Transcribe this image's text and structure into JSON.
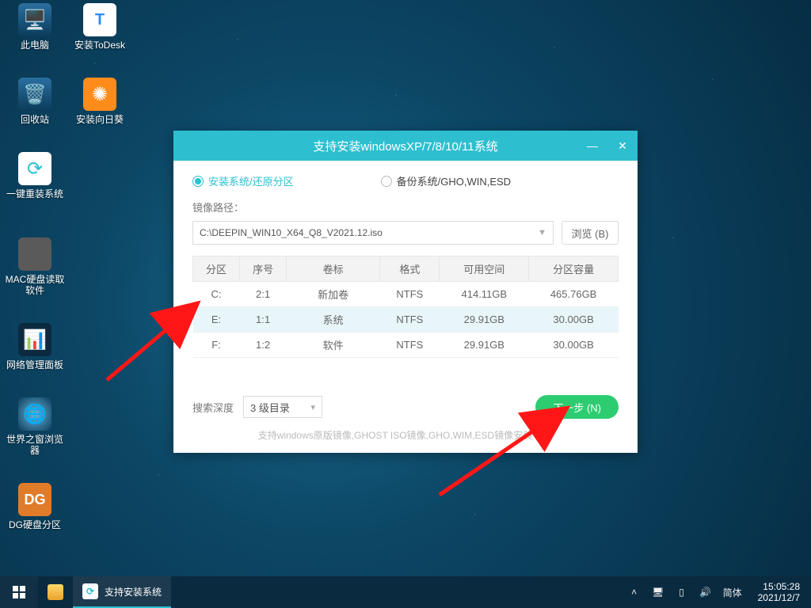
{
  "desktop_icons": [
    {
      "key": "pc",
      "label": "此电脑"
    },
    {
      "key": "todesk",
      "label": "安装ToDesk"
    },
    {
      "key": "recycle",
      "label": "回收站"
    },
    {
      "key": "sunflower",
      "label": "安装向日葵"
    },
    {
      "key": "reinstall",
      "label": "一键重装系统"
    },
    {
      "key": "macdisk",
      "label": "MAC硬盘读取软件"
    },
    {
      "key": "netpanel",
      "label": "网络管理面板"
    },
    {
      "key": "browser",
      "label": "世界之窗浏览器"
    },
    {
      "key": "dg",
      "label": "DG硬盘分区"
    }
  ],
  "window": {
    "title": "支持安装windowsXP/7/8/10/11系统",
    "radio_install": "安装系统/还原分区",
    "radio_backup": "备份系统/GHO,WIN,ESD",
    "path_label": "镜像路径：",
    "path_value": "C:\\DEEPIN_WIN10_X64_Q8_V2021.12.iso",
    "browse_label": "浏览 (B)",
    "table": {
      "headers": [
        "分区",
        "序号",
        "卷标",
        "格式",
        "可用空间",
        "分区容量"
      ],
      "rows": [
        {
          "drive": "C:",
          "num": "2:1",
          "vol": "新加卷",
          "fmt": "NTFS",
          "free": "414.11GB",
          "total": "465.76GB",
          "sel": false
        },
        {
          "drive": "E:",
          "num": "1:1",
          "vol": "系统",
          "fmt": "NTFS",
          "free": "29.91GB",
          "total": "30.00GB",
          "sel": true
        },
        {
          "drive": "F:",
          "num": "1:2",
          "vol": "软件",
          "fmt": "NTFS",
          "free": "29.91GB",
          "total": "30.00GB",
          "sel": false
        }
      ]
    },
    "depth_label": "搜索深度",
    "depth_value": "3 级目录",
    "next_label": "下一步 (N)",
    "support_text": "支持windows原版镜像,GHOST ISO镜像,GHO,WIM,ESD镜像安装 v1.0"
  },
  "taskbar": {
    "active_label": "支持安装系统",
    "ime": "简体",
    "time": "15:05:28",
    "date": "2021/12/7"
  }
}
